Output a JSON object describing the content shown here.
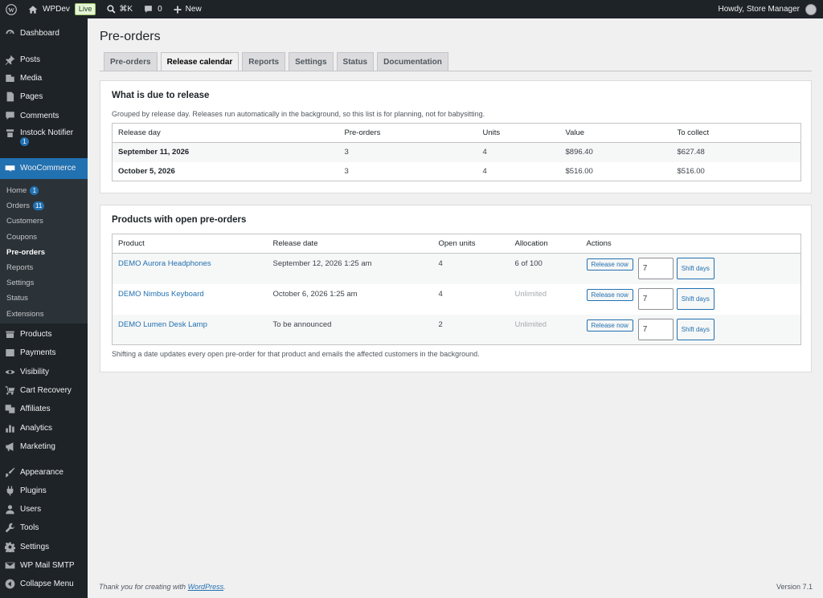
{
  "adminbar": {
    "site_name": "WPDev",
    "live_badge": "Live",
    "search_shortcut": "⌘K",
    "comments_count": "0",
    "new_label": "New",
    "howdy": "Howdy, Store Manager"
  },
  "sidebar": {
    "top": [
      {
        "label": "Dashboard",
        "icon": "dashboard-icon"
      }
    ],
    "group1": [
      {
        "label": "Posts",
        "icon": "pin-icon"
      },
      {
        "label": "Media",
        "icon": "media-icon"
      },
      {
        "label": "Pages",
        "icon": "pages-icon"
      },
      {
        "label": "Comments",
        "icon": "comments-icon"
      },
      {
        "label": "Instock Notifier",
        "icon": "bell-icon",
        "badge": "1"
      }
    ],
    "woocommerce": {
      "label": "WooCommerce",
      "sub": [
        {
          "label": "Home",
          "badge": "1"
        },
        {
          "label": "Orders",
          "badge": "11"
        },
        {
          "label": "Customers"
        },
        {
          "label": "Coupons"
        },
        {
          "label": "Pre-orders",
          "current": true
        },
        {
          "label": "Reports"
        },
        {
          "label": "Settings"
        },
        {
          "label": "Status"
        },
        {
          "label": "Extensions"
        }
      ]
    },
    "group2": [
      {
        "label": "Products",
        "icon": "products-icon"
      },
      {
        "label": "Payments",
        "icon": "payments-icon"
      },
      {
        "label": "Visibility",
        "icon": "eye-icon"
      },
      {
        "label": "Cart Recovery",
        "icon": "cart-icon"
      },
      {
        "label": "Affiliates",
        "icon": "affiliates-icon"
      },
      {
        "label": "Analytics",
        "icon": "analytics-icon"
      },
      {
        "label": "Marketing",
        "icon": "megaphone-icon"
      }
    ],
    "group3": [
      {
        "label": "Appearance",
        "icon": "brush-icon"
      },
      {
        "label": "Plugins",
        "icon": "plugin-icon"
      },
      {
        "label": "Users",
        "icon": "users-icon"
      },
      {
        "label": "Tools",
        "icon": "wrench-icon"
      },
      {
        "label": "Settings",
        "icon": "settings-icon"
      },
      {
        "label": "WP Mail SMTP",
        "icon": "mail-icon"
      },
      {
        "label": "Collapse Menu",
        "icon": "collapse-icon"
      }
    ]
  },
  "page": {
    "title": "Pre-orders",
    "tabs": [
      {
        "label": "Pre-orders",
        "active": false
      },
      {
        "label": "Release calendar",
        "active": true
      },
      {
        "label": "Reports",
        "active": false
      },
      {
        "label": "Settings",
        "active": false
      },
      {
        "label": "Status",
        "active": false
      },
      {
        "label": "Documentation",
        "active": false
      }
    ]
  },
  "due": {
    "heading": "What is due to release",
    "note": "Grouped by release day. Releases run automatically in the background, so this list is for planning, not for babysitting.",
    "columns": [
      "Release day",
      "Pre-orders",
      "Units",
      "Value",
      "To collect"
    ],
    "rows": [
      {
        "day": "September 11, 2026",
        "preorders": "3",
        "units": "4",
        "value": "$896.40",
        "collect": "$627.48"
      },
      {
        "day": "October 5, 2026",
        "preorders": "3",
        "units": "4",
        "value": "$516.00",
        "collect": "$516.00"
      }
    ]
  },
  "open": {
    "heading": "Products with open pre-orders",
    "columns": [
      "Product",
      "Release date",
      "Open units",
      "Allocation",
      "Actions"
    ],
    "rows": [
      {
        "product": "DEMO Aurora Headphones",
        "date": "September 12, 2026 1:25 am",
        "units": "4",
        "allocation": "6 of 100",
        "alloc_muted": false,
        "release_btn": "Release now",
        "days": "7",
        "shift_btn": "Shift days"
      },
      {
        "product": "DEMO Nimbus Keyboard",
        "date": "October 6, 2026 1:25 am",
        "units": "4",
        "allocation": "Unlimited",
        "alloc_muted": true,
        "release_btn": "Release now",
        "days": "7",
        "shift_btn": "Shift days"
      },
      {
        "product": "DEMO Lumen Desk Lamp",
        "date": "To be announced",
        "units": "2",
        "allocation": "Unlimited",
        "alloc_muted": true,
        "release_btn": "Release now",
        "days": "7",
        "shift_btn": "Shift days"
      }
    ],
    "footnote": "Shifting a date updates every open pre-order for that product and emails the affected customers in the background."
  },
  "footer": {
    "thanks_prefix": "Thank you for creating with ",
    "thanks_link": "WordPress",
    "thanks_suffix": ".",
    "version": "Version 7.1"
  },
  "colors": {
    "adminbar": "#1d2327",
    "sidebar": "#1d2327",
    "accent": "#2271b1",
    "submenu": "#2c3338"
  }
}
